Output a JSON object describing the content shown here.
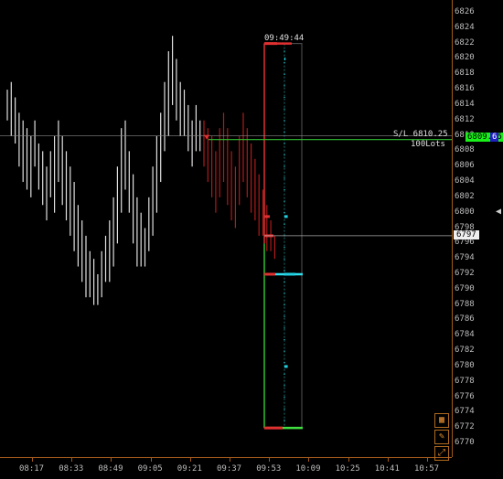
{
  "chart_data": {
    "type": "bar",
    "subtype": "ohlc-with-volume-profile",
    "symbol": "",
    "price_axis": {
      "min": 6770,
      "max": 6826,
      "step": 2,
      "ticks": [
        "6826",
        "6824",
        "6822",
        "6820",
        "6818",
        "6816",
        "6814",
        "6812",
        "6810",
        "6808",
        "6806",
        "6804",
        "6802",
        "6800",
        "6798",
        "6796",
        "6794",
        "6792",
        "6790",
        "6788",
        "6786",
        "6784",
        "6782",
        "6780",
        "6778",
        "6776",
        "6774",
        "6772",
        "6770"
      ]
    },
    "time_axis": {
      "ticks": [
        "08:17",
        "08:33",
        "08:49",
        "09:05",
        "09:21",
        "09:37",
        "09:53",
        "10:09",
        "10:25",
        "10:41",
        "10:57"
      ]
    },
    "markers": {
      "current_price": "6797",
      "sl_price": "6809.75",
      "sl_text": "S/L 6810.25",
      "sl_qty": "100Lots",
      "sl_suffix": "6",
      "profile_time": "09:49:44"
    },
    "profile": {
      "high": 6822,
      "low": 6772,
      "poc": 6792,
      "value_area_high": 6796,
      "value_area_low": 6772,
      "ask_levels": [
        {
          "price": 6799.5,
          "size": 3
        },
        {
          "price": 6792,
          "size": 10
        },
        {
          "price": 6780,
          "size": 3
        },
        {
          "price": 6820,
          "size": 1
        }
      ],
      "bid_levels": [
        {
          "price": 6799.5,
          "size": 3
        },
        {
          "price": 6797,
          "size": 5
        },
        {
          "price": 6792,
          "size": 6
        },
        {
          "price": 6772,
          "size": 10
        },
        {
          "price": 6822,
          "size": 7
        }
      ]
    },
    "series": [
      {
        "bars": [
          [
            6816,
            6812
          ],
          [
            6817,
            6810
          ],
          [
            6815,
            6809
          ],
          [
            6813,
            6806
          ],
          [
            6812,
            6804
          ],
          [
            6811,
            6803
          ],
          [
            6810,
            6802
          ],
          [
            6812,
            6806
          ],
          [
            6809,
            6803
          ],
          [
            6808,
            6801
          ],
          [
            6806,
            6799
          ],
          [
            6808,
            6802
          ],
          [
            6810,
            6800
          ],
          [
            6812,
            6804
          ],
          [
            6810,
            6801
          ],
          [
            6808,
            6799
          ],
          [
            6806,
            6797
          ],
          [
            6804,
            6795
          ],
          [
            6801,
            6793
          ],
          [
            6799,
            6791
          ],
          [
            6797,
            6789
          ],
          [
            6795,
            6789
          ],
          [
            6794,
            6788
          ],
          [
            6792,
            6788
          ],
          [
            6795,
            6789
          ],
          [
            6797,
            6791
          ],
          [
            6799,
            6791
          ],
          [
            6802,
            6793
          ],
          [
            6806,
            6796
          ],
          [
            6811,
            6800
          ],
          [
            6812,
            6803
          ],
          [
            6808,
            6800
          ],
          [
            6805,
            6796
          ],
          [
            6802,
            6793
          ],
          [
            6800,
            6793
          ],
          [
            6798,
            6793
          ],
          [
            6802,
            6795
          ],
          [
            6806,
            6797
          ],
          [
            6810,
            6800
          ],
          [
            6813,
            6804
          ],
          [
            6817,
            6808
          ],
          [
            6821,
            6810
          ],
          [
            6823,
            6814
          ],
          [
            6820,
            6812
          ],
          [
            6817,
            6810
          ],
          [
            6816,
            6810
          ],
          [
            6814,
            6808
          ],
          [
            6812,
            6806
          ],
          [
            6814,
            6808
          ],
          [
            6812,
            6808
          ]
        ],
        "color": "#e0e0e0"
      },
      {
        "bars": [
          [
            6812,
            6806
          ],
          [
            6811,
            6804
          ],
          [
            6810,
            6802
          ],
          [
            6808,
            6800
          ],
          [
            6811,
            6802
          ],
          [
            6813,
            6804
          ],
          [
            6811,
            6801
          ],
          [
            6808,
            6799
          ],
          [
            6806,
            6798
          ],
          [
            6810,
            6801
          ],
          [
            6813,
            6804
          ],
          [
            6811,
            6802
          ],
          [
            6809,
            6800
          ],
          [
            6807,
            6799
          ],
          [
            6805,
            6797
          ],
          [
            6803,
            6797
          ],
          [
            6801,
            6795
          ],
          [
            6799,
            6795
          ],
          [
            6797,
            6794
          ]
        ],
        "color": "#b01a1a"
      }
    ],
    "colors": {
      "axis": "#a05a1a",
      "bid": "#e03030",
      "ask": "#20d0e0",
      "value_area": "#30c030",
      "profile_high_line": "#e03030",
      "poc_line": "#30e0f0",
      "profile_low_line": "#40e040",
      "sl_box": "#19f019",
      "sl_suffix_box": "#2020c0"
    }
  }
}
